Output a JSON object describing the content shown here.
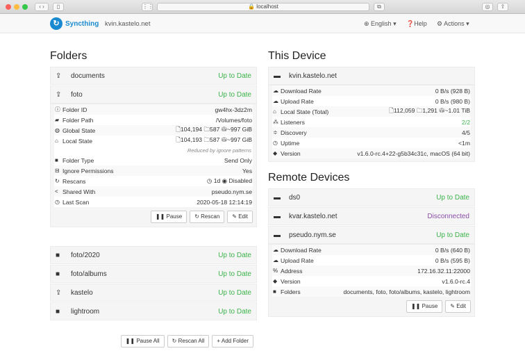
{
  "browser": {
    "url": "localhost"
  },
  "nav": {
    "brand": "Syncthing",
    "device": "kvin.kastelo.net",
    "language": "English",
    "help": "Help",
    "actions": "Actions"
  },
  "folders": {
    "title": "Folders",
    "items": [
      {
        "name": "documents",
        "status": "Up to Date",
        "icon": "upload-icon"
      },
      {
        "name": "foto",
        "status": "Up to Date",
        "icon": "upload-icon",
        "expanded": true
      },
      {
        "name": "foto/2020",
        "status": "Up to Date",
        "icon": "folder-icon"
      },
      {
        "name": "foto/albums",
        "status": "Up to Date",
        "icon": "folder-icon"
      },
      {
        "name": "kastelo",
        "status": "Up to Date",
        "icon": "upload-icon"
      },
      {
        "name": "lightroom",
        "status": "Up to Date",
        "icon": "folder-icon"
      }
    ],
    "details": [
      {
        "label": "Folder ID",
        "value": "gw4hx-3dz2m",
        "icon": "info-icon"
      },
      {
        "label": "Folder Path",
        "value": "/Volumes/foto",
        "icon": "folder-open-icon"
      },
      {
        "label": "Global State",
        "value": "🗋104,194  🗀587  ⛁~997 GiB",
        "icon": "globe-icon"
      },
      {
        "label": "Local State",
        "value": "🗋104,193  🗀587  ⛁~997 GiB",
        "icon": "home-icon"
      },
      {
        "label": "Folder Type",
        "value": "Send Only",
        "icon": "folder-icon"
      },
      {
        "label": "Ignore Permissions",
        "value": "Yes",
        "icon": "minus-square-icon"
      },
      {
        "label": "Rescans",
        "value": "◷ 1d   ◉ Disabled",
        "icon": "refresh-icon"
      },
      {
        "label": "Shared With",
        "value": "pseudo.nym.se",
        "icon": "share-icon"
      },
      {
        "label": "Last Scan",
        "value": "2020-05-18 12:14:19",
        "icon": "clock-icon"
      }
    ],
    "note": "Reduced by ignore patterns",
    "buttons": [
      "Pause",
      "Rescan",
      "Edit"
    ],
    "footer_buttons": [
      "Pause All",
      "Rescan All",
      "Add Folder"
    ]
  },
  "this_device": {
    "title": "This Device",
    "name": "kvin.kastelo.net",
    "rows": [
      {
        "label": "Download Rate",
        "value": "0 B/s (928 B)",
        "icon": "cloud-download-icon"
      },
      {
        "label": "Upload Rate",
        "value": "0 B/s (980 B)",
        "icon": "cloud-upload-icon"
      },
      {
        "label": "Local State (Total)",
        "value": "🗋112,059  🗀1,291  ⛁~1.01 TiB",
        "icon": "home-icon"
      },
      {
        "label": "Listeners",
        "value": "2/2",
        "icon": "sitemap-icon",
        "ok": true
      },
      {
        "label": "Discovery",
        "value": "4/5",
        "icon": "signpost-icon"
      },
      {
        "label": "Uptime",
        "value": "<1m",
        "icon": "clock-icon"
      },
      {
        "label": "Version",
        "value": "v1.6.0-rc.4+22-g5b34c31c, macOS (64 bit)",
        "icon": "tag-icon"
      }
    ]
  },
  "remote": {
    "title": "Remote Devices",
    "devices": [
      {
        "name": "ds0",
        "status": "Up to Date"
      },
      {
        "name": "kvar.kastelo.net",
        "status": "Disconnected"
      },
      {
        "name": "pseudo.nym.se",
        "status": "Up to Date",
        "expanded": true
      }
    ],
    "rows": [
      {
        "label": "Download Rate",
        "value": "0 B/s (640 B)",
        "icon": "cloud-download-icon"
      },
      {
        "label": "Upload Rate",
        "value": "0 B/s (595 B)",
        "icon": "cloud-upload-icon"
      },
      {
        "label": "Address",
        "value": "172.16.32.11:22000",
        "icon": "link-icon"
      },
      {
        "label": "Version",
        "value": "v1.6.0-rc.4",
        "icon": "tag-icon"
      },
      {
        "label": "Folders",
        "value": "documents, foto, foto/albums, kastelo, lightroom",
        "icon": "folder-icon"
      }
    ],
    "buttons": [
      "Pause",
      "Edit"
    ]
  },
  "colors": {
    "ok": "#3cb34b",
    "disconnected": "#8a4ea8",
    "brand": "#1a8ad0"
  }
}
